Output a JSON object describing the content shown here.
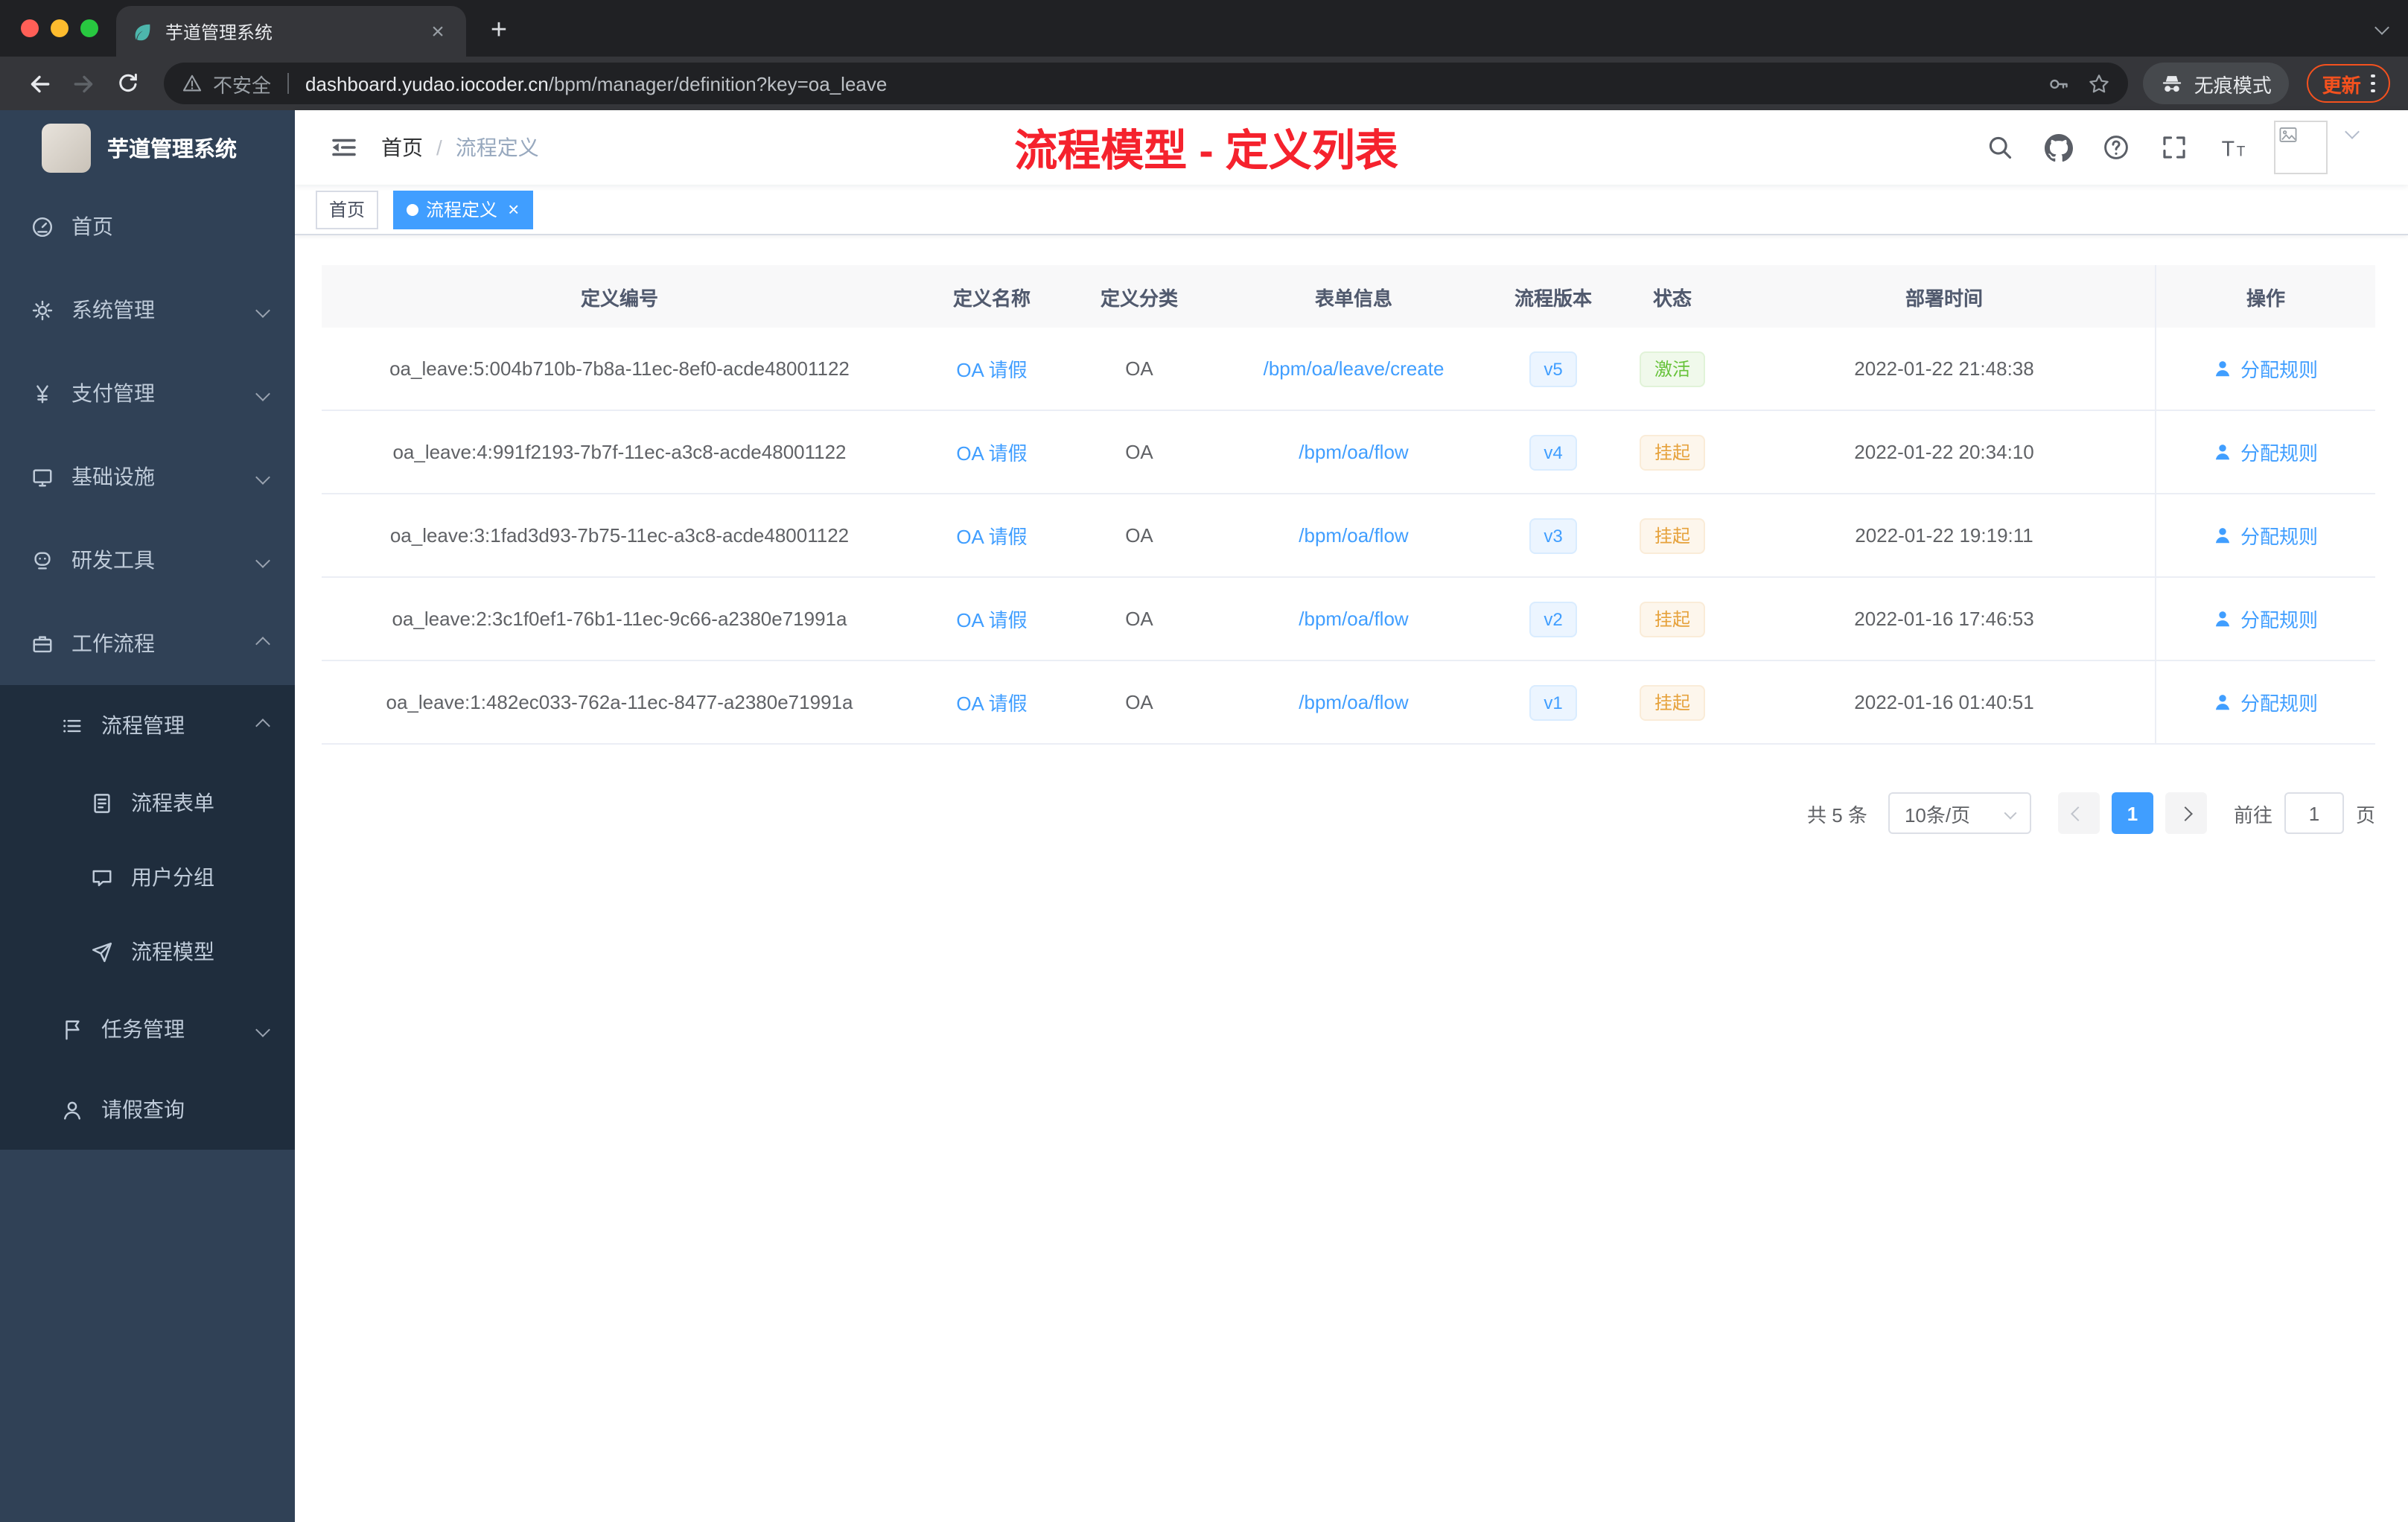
{
  "browser": {
    "tab_title": "芋道管理系统",
    "close_tab": "×",
    "new_tab_button": "+",
    "security_label": "不安全",
    "url_domain": "dashboard.yudao.iocoder.cn",
    "url_path": "/bpm/manager/definition?key=oa_leave",
    "incognito_label": "无痕模式",
    "update_label": "更新"
  },
  "sidebar": {
    "logo_title": "芋道管理系统",
    "items": [
      {
        "label": "首页",
        "icon": "dashboard-icon",
        "level": 1,
        "sub": false
      },
      {
        "label": "系统管理",
        "icon": "gear-icon",
        "level": 1,
        "arrow": "down",
        "sub": false
      },
      {
        "label": "支付管理",
        "icon": "yen-icon",
        "level": 1,
        "arrow": "down",
        "sub": false
      },
      {
        "label": "基础设施",
        "icon": "monitor-icon",
        "level": 1,
        "arrow": "down",
        "sub": false
      },
      {
        "label": "研发工具",
        "icon": "tool-icon",
        "level": 1,
        "arrow": "down",
        "sub": false
      },
      {
        "label": "工作流程",
        "icon": "briefcase-icon",
        "level": 1,
        "arrow": "up",
        "sub": false
      },
      {
        "label": "流程管理",
        "icon": "list-icon",
        "level": 2,
        "arrow": "up",
        "sub": true
      },
      {
        "label": "流程表单",
        "icon": "form-icon",
        "level": 3,
        "sub": true
      },
      {
        "label": "用户分组",
        "icon": "chat-icon",
        "level": 3,
        "sub": true
      },
      {
        "label": "流程模型",
        "icon": "send-icon",
        "level": 3,
        "sub": true
      },
      {
        "label": "任务管理",
        "icon": "flag-icon",
        "level": 2,
        "arrow": "down",
        "sub": true
      },
      {
        "label": "请假查询",
        "icon": "user-icon",
        "level": 2,
        "sub": true
      }
    ]
  },
  "header": {
    "breadcrumb": {
      "home": "首页",
      "separator": "/",
      "current": "流程定义"
    },
    "annotation": "流程模型 - 定义列表"
  },
  "tags_view": {
    "tags": [
      {
        "label": "首页",
        "active": false
      },
      {
        "label": "流程定义",
        "active": true,
        "close": "×"
      }
    ]
  },
  "table": {
    "columns": [
      "定义编号",
      "定义名称",
      "定义分类",
      "表单信息",
      "流程版本",
      "状态",
      "部署时间",
      "操作"
    ],
    "action_label": "分配规则",
    "rows": [
      {
        "id": "oa_leave:5:004b710b-7b8a-11ec-8ef0-acde48001122",
        "name": "OA 请假",
        "category": "OA",
        "form": "/bpm/oa/leave/create",
        "version": "v5",
        "status": "激活",
        "status_type": "success",
        "time": "2022-01-22 21:48:38"
      },
      {
        "id": "oa_leave:4:991f2193-7b7f-11ec-a3c8-acde48001122",
        "name": "OA 请假",
        "category": "OA",
        "form": "/bpm/oa/flow",
        "version": "v4",
        "status": "挂起",
        "status_type": "warning",
        "time": "2022-01-22 20:34:10"
      },
      {
        "id": "oa_leave:3:1fad3d93-7b75-11ec-a3c8-acde48001122",
        "name": "OA 请假",
        "category": "OA",
        "form": "/bpm/oa/flow",
        "version": "v3",
        "status": "挂起",
        "status_type": "warning",
        "time": "2022-01-22 19:19:11"
      },
      {
        "id": "oa_leave:2:3c1f0ef1-76b1-11ec-9c66-a2380e71991a",
        "name": "OA 请假",
        "category": "OA",
        "form": "/bpm/oa/flow",
        "version": "v2",
        "status": "挂起",
        "status_type": "warning",
        "time": "2022-01-16 17:46:53"
      },
      {
        "id": "oa_leave:1:482ec033-762a-11ec-8477-a2380e71991a",
        "name": "OA 请假",
        "category": "OA",
        "form": "/bpm/oa/flow",
        "version": "v1",
        "status": "挂起",
        "status_type": "warning",
        "time": "2022-01-16 01:40:51"
      }
    ]
  },
  "pagination": {
    "total": "共 5 条",
    "page_size": "10条/页",
    "current_page": "1",
    "goto_label": "前往",
    "goto_value": "1",
    "goto_unit": "页"
  },
  "colors": {
    "accent": "#409eff",
    "success": "#67c23a",
    "warning": "#e6a23c",
    "annotation_red": "#f5222d",
    "sidebar_bg": "#304156",
    "submenu_bg": "#1f2d3d"
  }
}
